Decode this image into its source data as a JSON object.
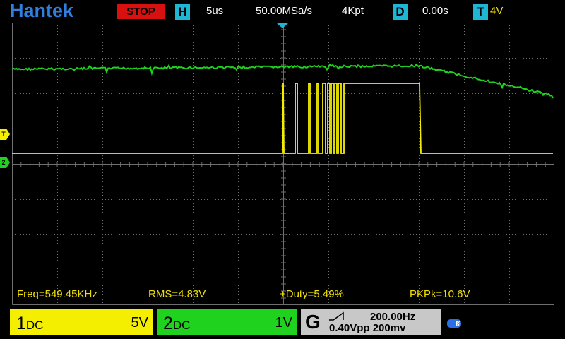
{
  "topbar": {
    "brand": "Hantek",
    "run_state": "STOP",
    "horiz_badge": "H",
    "timebase": "5us",
    "sample_rate": "50.00MSa/s",
    "memory_depth": "4Kpt",
    "delay_badge": "D",
    "delay": "0.00s",
    "trigger_badge": "T",
    "trigger_level": "4V"
  },
  "markers": {
    "trigger": "T",
    "ch2": "2"
  },
  "colors": {
    "ch1": "#f4ef00",
    "ch2": "#1ed21e",
    "grid": "#6f6f6f",
    "accent": "#1fb6d6",
    "stop": "#d81010"
  },
  "measurements": {
    "freq": "Freq=549.45KHz",
    "rms": "RMS=4.83V",
    "duty": "+Duty=5.49%",
    "pkpk": "PKPk=10.6V"
  },
  "channel1": {
    "number": "1",
    "coupling": "DC",
    "scale": "5V"
  },
  "channel2": {
    "number": "2",
    "coupling": "DC",
    "scale": "1V"
  },
  "generator": {
    "label": "G",
    "frequency": "200.00Hz",
    "amplitude": "0.40Vpp",
    "offset": "200mv",
    "wave_icon": "ramp-wave-icon"
  },
  "status": {
    "battery_icon": "battery-icon"
  }
}
